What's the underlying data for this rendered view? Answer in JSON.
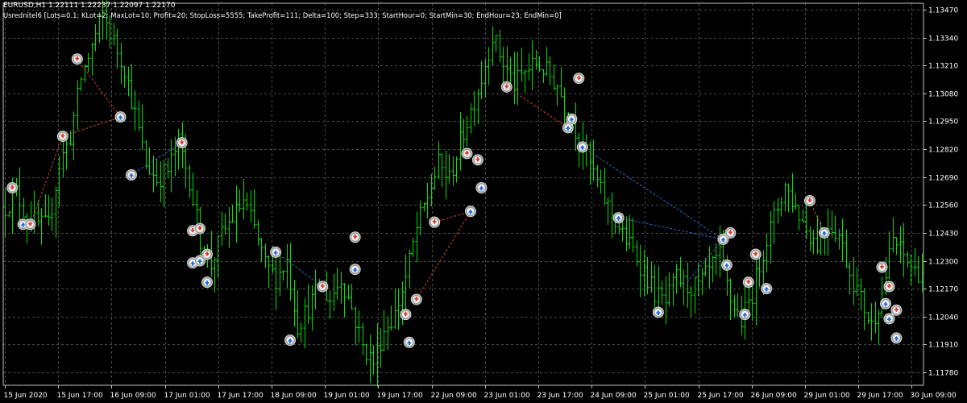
{
  "header": {
    "symbol_line": "EURUSD,H1  1.22111 1.22237 1.22097 1.22170",
    "params_line": "Usrednitel6 [Lots=0.1; KLot=2; MaxLot=10; Profit=20; StopLoss=5555; TakeProfit=111; Delta=100; Step=333; StartHour=0; StartMin=30; EndHour=23; EndMin=0]"
  },
  "colors": {
    "background": "#000000",
    "grid": "#4a4a4a",
    "frame": "#c0c0c0",
    "bar_up": "#00e000",
    "bar_down": "#00e000",
    "buy_marker": "#1e6fd9",
    "sell_marker": "#e0402a",
    "buy_line": "#2a6cc8",
    "sell_line": "#d0402a"
  },
  "chart_data": {
    "type": "bar",
    "symbol": "EURUSD",
    "timeframe": "H1",
    "ylim": [
      1.1172,
      1.135
    ],
    "y_ticks": [
      "1.13470",
      "1.13340",
      "1.13210",
      "1.13080",
      "1.12950",
      "1.12820",
      "1.12690",
      "1.12560",
      "1.12430",
      "1.12300",
      "1.12170",
      "1.12040",
      "1.11910",
      "1.11780"
    ],
    "x_ticks": [
      "15 Jun 2020",
      "15 Jun 17:00",
      "16 Jun 09:00",
      "17 Jun 01:00",
      "17 Jun 17:00",
      "18 Jun 09:00",
      "19 Jun 01:00",
      "19 Jun 17:00",
      "22 Jun 09:00",
      "23 Jun 01:00",
      "23 Jun 17:00",
      "24 Jun 09:00",
      "25 Jun 01:00",
      "25 Jun 17:00",
      "26 Jun 09:00",
      "29 Jun 01:00",
      "29 Jun 17:00",
      "30 Jun 09:00"
    ],
    "grid": true,
    "path": [
      [
        0,
        1.1255
      ],
      [
        3,
        1.1262
      ],
      [
        6,
        1.125
      ],
      [
        9,
        1.1247
      ],
      [
        12,
        1.1246
      ],
      [
        15,
        1.1275
      ],
      [
        18,
        1.1288
      ],
      [
        21,
        1.1315
      ],
      [
        24,
        1.133
      ],
      [
        27,
        1.1345
      ],
      [
        30,
        1.1332
      ],
      [
        33,
        1.132
      ],
      [
        36,
        1.1298
      ],
      [
        39,
        1.1275
      ],
      [
        42,
        1.1268
      ],
      [
        45,
        1.1272
      ],
      [
        48,
        1.1285
      ],
      [
        51,
        1.1268
      ],
      [
        54,
        1.124
      ],
      [
        57,
        1.1228
      ],
      [
        60,
        1.1242
      ],
      [
        63,
        1.125
      ],
      [
        66,
        1.1258
      ],
      [
        69,
        1.1245
      ],
      [
        72,
        1.1228
      ],
      [
        75,
        1.1222
      ],
      [
        78,
        1.123
      ],
      [
        81,
        1.12
      ],
      [
        84,
        1.1208
      ],
      [
        87,
        1.1218
      ],
      [
        90,
        1.1212
      ],
      [
        93,
        1.1222
      ],
      [
        96,
        1.1208
      ],
      [
        99,
        1.119
      ],
      [
        102,
        1.1183
      ],
      [
        105,
        1.1198
      ],
      [
        108,
        1.1205
      ],
      [
        111,
        1.1222
      ],
      [
        114,
        1.1245
      ],
      [
        117,
        1.126
      ],
      [
        120,
        1.1275
      ],
      [
        123,
        1.1268
      ],
      [
        126,
        1.1285
      ],
      [
        129,
        1.13
      ],
      [
        132,
        1.1315
      ],
      [
        135,
        1.1335
      ],
      [
        138,
        1.1322
      ],
      [
        141,
        1.1312
      ],
      [
        144,
        1.1318
      ],
      [
        147,
        1.1322
      ],
      [
        150,
        1.1318
      ],
      [
        153,
        1.1312
      ],
      [
        156,
        1.1298
      ],
      [
        159,
        1.1288
      ],
      [
        162,
        1.1275
      ],
      [
        165,
        1.1262
      ],
      [
        168,
        1.1252
      ],
      [
        171,
        1.1242
      ],
      [
        174,
        1.1235
      ],
      [
        177,
        1.1225
      ],
      [
        180,
        1.1215
      ],
      [
        183,
        1.121
      ],
      [
        186,
        1.1222
      ],
      [
        189,
        1.1218
      ],
      [
        192,
        1.1218
      ],
      [
        195,
        1.1225
      ],
      [
        198,
        1.1232
      ],
      [
        201,
        1.1212
      ],
      [
        204,
        1.1202
      ],
      [
        207,
        1.1215
      ],
      [
        210,
        1.1235
      ],
      [
        213,
        1.125
      ],
      [
        216,
        1.1265
      ],
      [
        219,
        1.1255
      ],
      [
        222,
        1.1245
      ],
      [
        225,
        1.1238
      ],
      [
        228,
        1.1248
      ],
      [
        231,
        1.1242
      ],
      [
        234,
        1.1225
      ],
      [
        237,
        1.1212
      ],
      [
        240,
        1.12
      ],
      [
        243,
        1.1215
      ],
      [
        246,
        1.124
      ],
      [
        249,
        1.1232
      ],
      [
        252,
        1.1225
      ]
    ],
    "trades": [
      {
        "type": "sell",
        "bar": 2,
        "price": 1.1264
      },
      {
        "type": "buy",
        "bar": 5,
        "price": 1.1247
      },
      {
        "type": "sell",
        "bar": 7,
        "price": 1.1247
      },
      {
        "type": "sell",
        "bar": 16,
        "price": 1.1288
      },
      {
        "type": "sell",
        "bar": 20,
        "price": 1.1324
      },
      {
        "type": "buy",
        "bar": 32,
        "price": 1.1297
      },
      {
        "type": "buy",
        "bar": 35,
        "price": 1.127
      },
      {
        "type": "sell",
        "bar": 49,
        "price": 1.1285
      },
      {
        "type": "sell",
        "bar": 52,
        "price": 1.1244
      },
      {
        "type": "sell",
        "bar": 54,
        "price": 1.1245
      },
      {
        "type": "sell",
        "bar": 56,
        "price": 1.1233
      },
      {
        "type": "buy",
        "bar": 52,
        "price": 1.1229
      },
      {
        "type": "buy",
        "bar": 54,
        "price": 1.123
      },
      {
        "type": "buy",
        "bar": 56,
        "price": 1.122
      },
      {
        "type": "buy",
        "bar": 75,
        "price": 1.1234
      },
      {
        "type": "buy",
        "bar": 79,
        "price": 1.1193
      },
      {
        "type": "sell",
        "bar": 88,
        "price": 1.1218
      },
      {
        "type": "sell",
        "bar": 97,
        "price": 1.1241
      },
      {
        "type": "buy",
        "bar": 97,
        "price": 1.1226
      },
      {
        "type": "buy",
        "bar": 112,
        "price": 1.1192
      },
      {
        "type": "sell",
        "bar": 111,
        "price": 1.1205
      },
      {
        "type": "sell",
        "bar": 114,
        "price": 1.1212
      },
      {
        "type": "sell",
        "bar": 119,
        "price": 1.1248
      },
      {
        "type": "buy",
        "bar": 129,
        "price": 1.1253
      },
      {
        "type": "sell",
        "bar": 128,
        "price": 1.128
      },
      {
        "type": "sell",
        "bar": 131,
        "price": 1.1277
      },
      {
        "type": "buy",
        "bar": 132,
        "price": 1.1264
      },
      {
        "type": "sell",
        "bar": 139,
        "price": 1.1311
      },
      {
        "type": "buy",
        "bar": 156,
        "price": 1.1292
      },
      {
        "type": "buy",
        "bar": 157,
        "price": 1.1296
      },
      {
        "type": "sell",
        "bar": 159,
        "price": 1.1315
      },
      {
        "type": "buy",
        "bar": 160,
        "price": 1.1283
      },
      {
        "type": "buy",
        "bar": 170,
        "price": 1.125
      },
      {
        "type": "buy",
        "bar": 181,
        "price": 1.1206
      },
      {
        "type": "buy",
        "bar": 199,
        "price": 1.124
      },
      {
        "type": "sell",
        "bar": 201,
        "price": 1.1243
      },
      {
        "type": "buy",
        "bar": 200,
        "price": 1.1228
      },
      {
        "type": "sell",
        "bar": 206,
        "price": 1.122
      },
      {
        "type": "sell",
        "bar": 208,
        "price": 1.1233
      },
      {
        "type": "buy",
        "bar": 205,
        "price": 1.1205
      },
      {
        "type": "buy",
        "bar": 211,
        "price": 1.1217
      },
      {
        "type": "sell",
        "bar": 223,
        "price": 1.1258
      },
      {
        "type": "buy",
        "bar": 227,
        "price": 1.1243
      },
      {
        "type": "sell",
        "bar": 243,
        "price": 1.1227
      },
      {
        "type": "sell",
        "bar": 245,
        "price": 1.1218
      },
      {
        "type": "buy",
        "bar": 244,
        "price": 1.121
      },
      {
        "type": "sell",
        "bar": 247,
        "price": 1.1207
      },
      {
        "type": "buy",
        "bar": 245,
        "price": 1.1203
      },
      {
        "type": "buy",
        "bar": 247,
        "price": 1.1194
      }
    ],
    "trade_lines": [
      {
        "type": "sell",
        "from": [
          7,
          1.1247
        ],
        "to": [
          16,
          1.1288
        ]
      },
      {
        "type": "sell",
        "from": [
          16,
          1.1288
        ],
        "to": [
          32,
          1.1297
        ]
      },
      {
        "type": "sell",
        "from": [
          20,
          1.1324
        ],
        "to": [
          32,
          1.1297
        ]
      },
      {
        "type": "buy",
        "from": [
          35,
          1.127
        ],
        "to": [
          49,
          1.1285
        ]
      },
      {
        "type": "buy",
        "from": [
          75,
          1.1234
        ],
        "to": [
          88,
          1.1218
        ]
      },
      {
        "type": "sell",
        "from": [
          114,
          1.1212
        ],
        "to": [
          129,
          1.1253
        ]
      },
      {
        "type": "sell",
        "from": [
          119,
          1.1248
        ],
        "to": [
          129,
          1.1253
        ]
      },
      {
        "type": "sell",
        "from": [
          139,
          1.1311
        ],
        "to": [
          156,
          1.1292
        ]
      },
      {
        "type": "buy",
        "from": [
          160,
          1.1283
        ],
        "to": [
          199,
          1.124
        ]
      },
      {
        "type": "buy",
        "from": [
          170,
          1.125
        ],
        "to": [
          199,
          1.124
        ]
      },
      {
        "type": "buy",
        "from": [
          189,
          1.122
        ],
        "to": [
          199,
          1.124
        ]
      },
      {
        "type": "sell",
        "from": [
          223,
          1.1258
        ],
        "to": [
          227,
          1.1243
        ]
      }
    ]
  }
}
